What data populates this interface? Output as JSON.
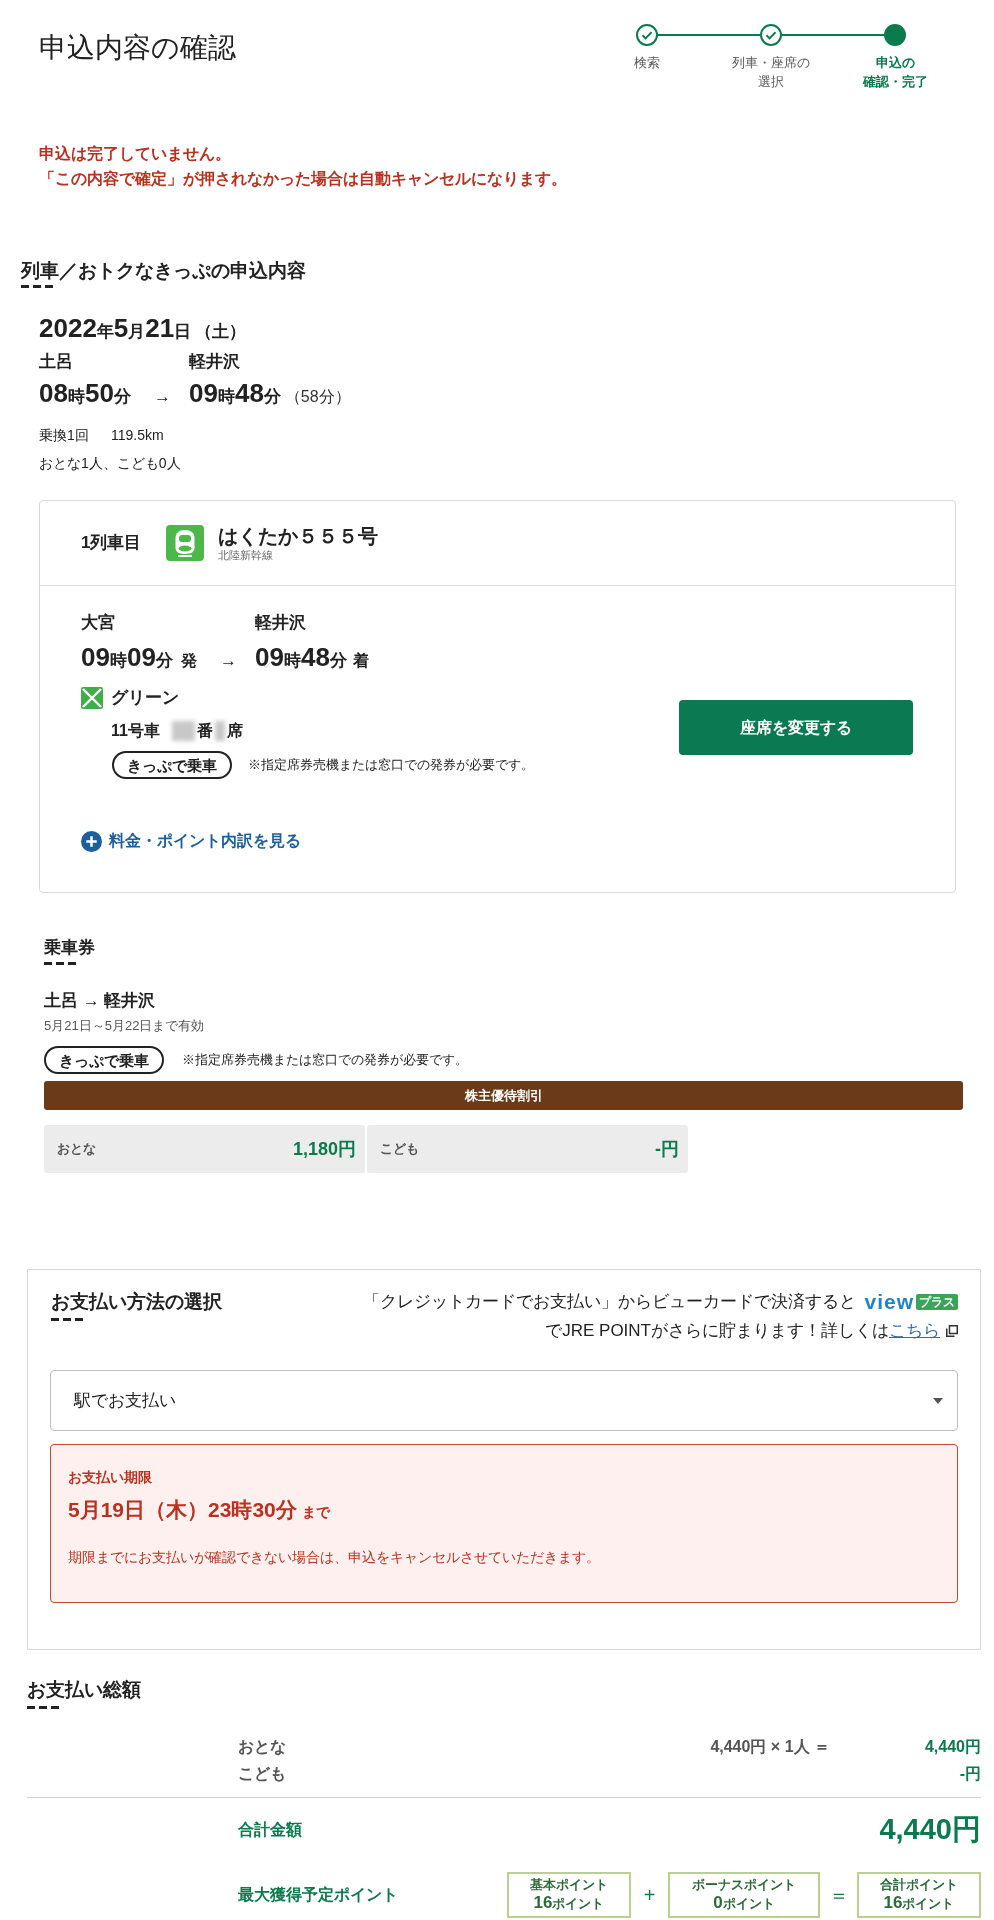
{
  "page": {
    "title": "申込内容の確認"
  },
  "steps": [
    {
      "label_lines": [
        "検索"
      ],
      "completed": true,
      "current": false
    },
    {
      "label_lines": [
        "列車・座席の",
        "選択"
      ],
      "completed": true,
      "current": false
    },
    {
      "label_lines": [
        "申込の",
        "確認・完了"
      ],
      "completed": false,
      "current": true
    }
  ],
  "notice": {
    "lines": [
      "申込は完了していません。",
      "「この内容で確定」が押されなかった場合は自動キャンセルになります。"
    ]
  },
  "trip": {
    "heading": "列車／おトクなきっぷの申込内容",
    "date": "2022年5月21日",
    "weekday": "（土）",
    "from": "土呂",
    "to": "軽井沢",
    "depart": "08時50分",
    "arrow": "→",
    "arrive": "09時48分",
    "duration": "（58分）",
    "transfers": "乗換1回",
    "distance": "119.5km",
    "passengers": "おとな1人、こども0人"
  },
  "train": {
    "index_label": "1列車目",
    "name": "はくたか５５５号",
    "line": "北陸新幹線",
    "from": "大宮",
    "to": "軽井沢",
    "depart": "09時09分",
    "depart_suffix": "発",
    "arrow": "→",
    "arrive": "09時48分",
    "arrive_suffix": "着",
    "seat_class": "グリーン",
    "car": "11号車",
    "row_suffix": "番",
    "seat_suffix": "席",
    "ticket_badge": "きっぷで乗車",
    "ticket_note": "※指定席券売機または窓口での発券が必要です。",
    "change_seat_button": "座席を変更する",
    "breakdown_link": "料金・ポイント内訳を見る"
  },
  "fare_ticket": {
    "heading": "乗車券",
    "route": "土呂 → 軽井沢",
    "validity": "5月21日～5月22日まで有効",
    "ticket_badge": "きっぷで乗車",
    "ticket_note": "※指定席券売機または窓口での発券が必要です。",
    "discount_bar": "株主優待割引",
    "prices": [
      {
        "label": "おとな",
        "amount": "1,180円"
      },
      {
        "label": "こども",
        "amount": "-円"
      }
    ]
  },
  "payment": {
    "heading": "お支払い方法の選択",
    "promo_line1": "「クレジットカードでお支払い」からビューカードで決済すると",
    "promo_logo": "view",
    "promo_logo_badge": "プラス",
    "promo_line2": "でJRE POINTがさらに貯まります！詳しくは",
    "promo_link": "こちら",
    "method_select": {
      "value": "駅でお支払い"
    },
    "deadline": {
      "title": "お支払い期限",
      "date": "5月19日（木）23時30分",
      "suffix": "まで",
      "note": "期限までにお支払いが確認できない場合は、申込をキャンセルさせていただきます。"
    }
  },
  "totals": {
    "heading": "お支払い総額",
    "rows": [
      {
        "label": "おとな",
        "formula": "4,440円 × 1人 ＝",
        "amount": "4,440円"
      },
      {
        "label": "こども",
        "amount": "-円"
      }
    ],
    "total_label": "合計金額",
    "total_amount": "4,440円",
    "points_label": "最大獲得予定ポイント",
    "points": [
      {
        "label": "基本ポイント",
        "value": "16ポイント"
      },
      {
        "label": "ボーナスポイント",
        "value": "0ポイント"
      },
      {
        "label": "合計ポイント",
        "value": "16ポイント"
      }
    ],
    "operators": [
      "+",
      "＝"
    ]
  }
}
